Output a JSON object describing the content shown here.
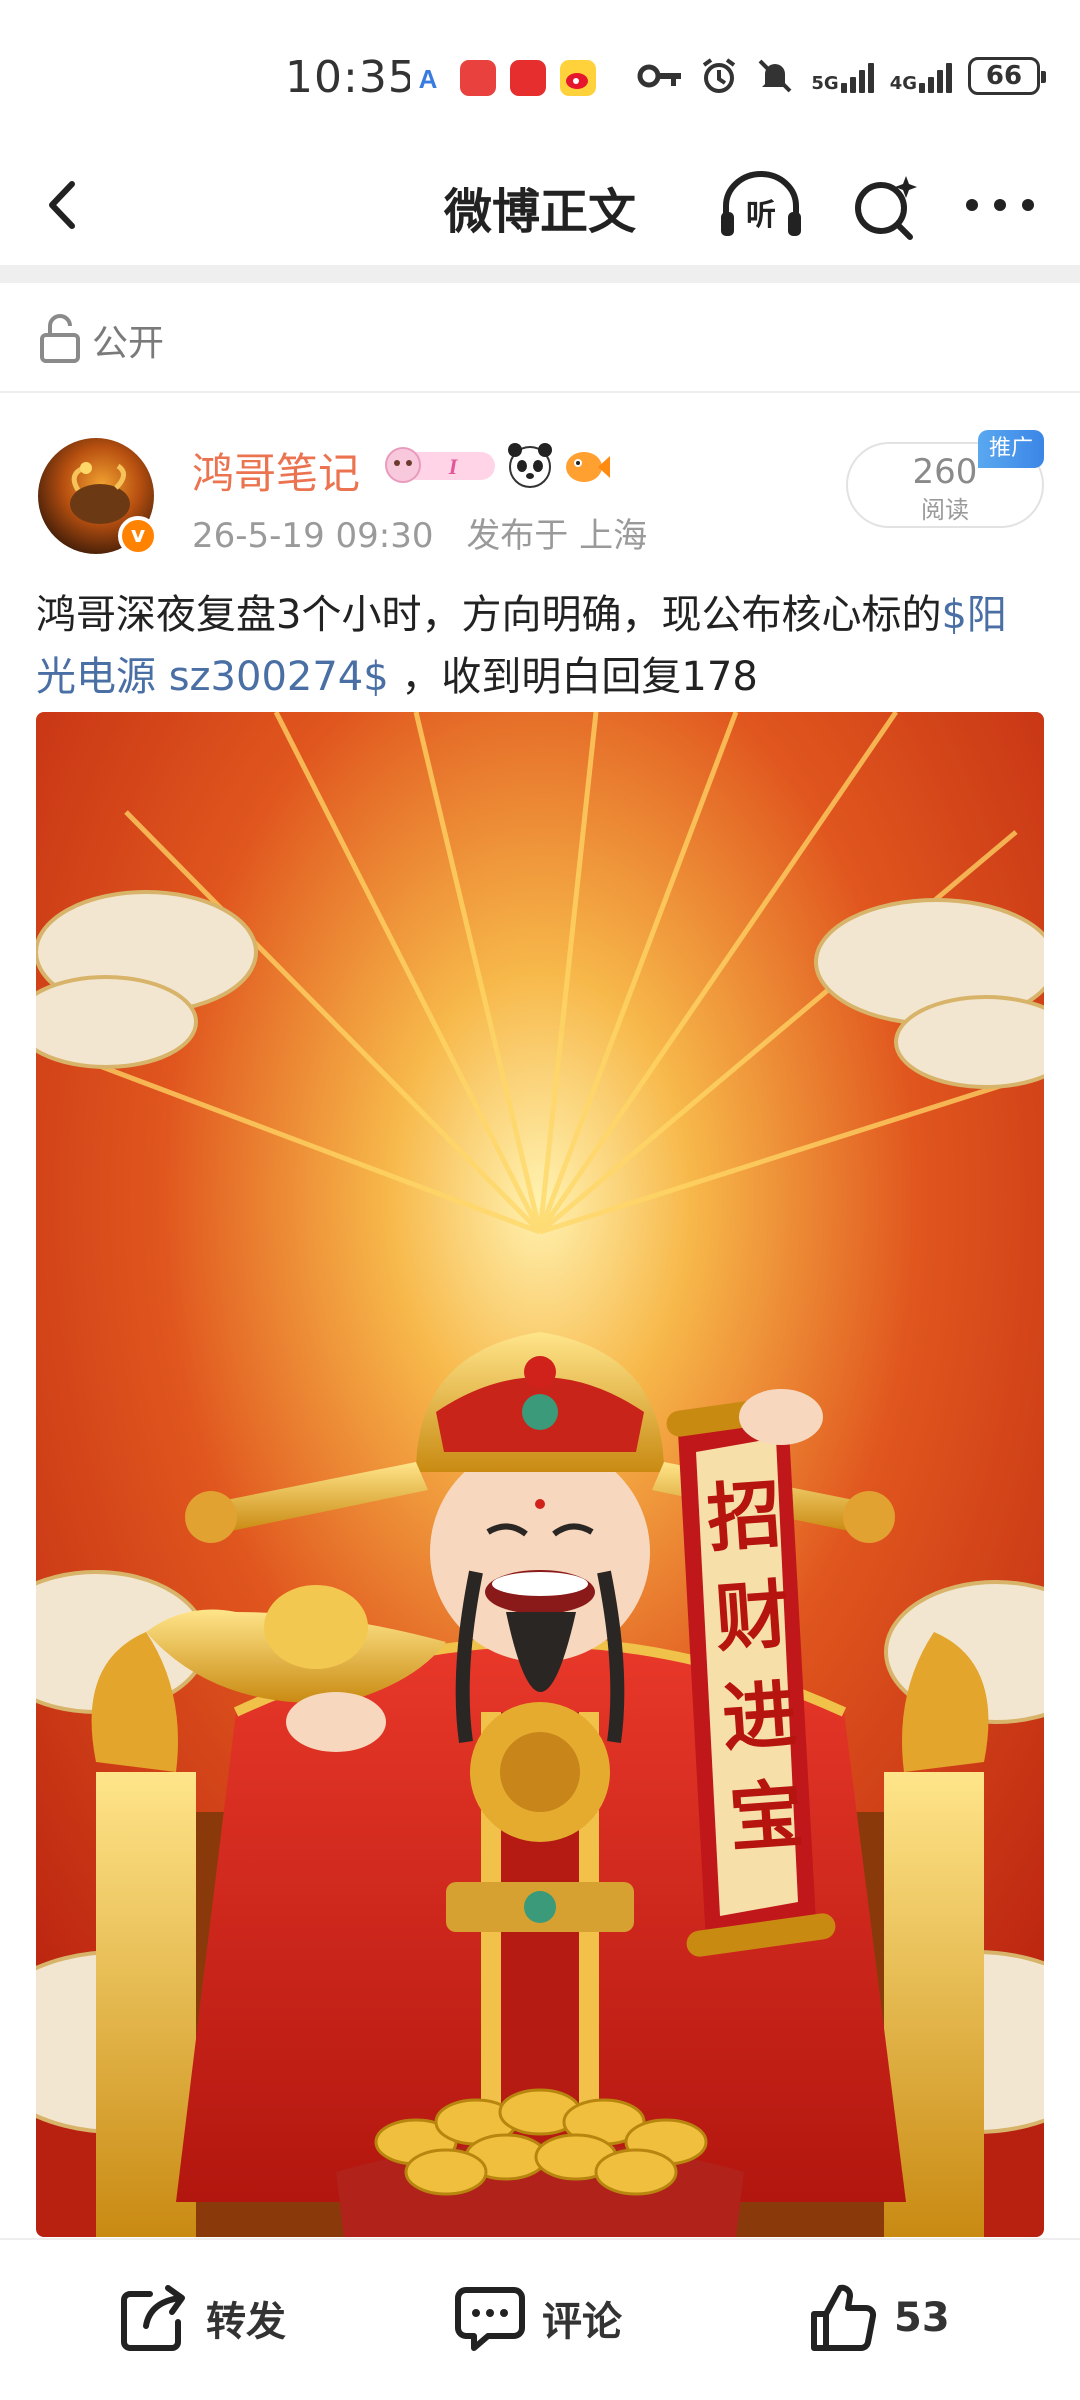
{
  "status_bar": {
    "time": "10:35",
    "network_1": "5G",
    "network_2": "4G",
    "battery": "66",
    "icons": [
      "key-icon",
      "alarm-icon",
      "mute-icon"
    ],
    "app_icons": [
      "a-app-icon",
      "huawei-store-icon",
      "red-app-icon",
      "weibo-app-icon"
    ]
  },
  "navbar": {
    "title": "微博正文",
    "listen_label": "听"
  },
  "privacy": {
    "label": "公开"
  },
  "post": {
    "author": "鸿哥笔记",
    "timestamp": "26-5-19 09:30",
    "location": "发布于 上海",
    "read_count": "260",
    "read_label": "阅读",
    "promo_tag": "推广",
    "verified_icon": "v",
    "badge_letter": "I",
    "text_part1": "鸿哥深夜复盘3个小时，方向明确，现公布核心标的",
    "topic": "$阳光电源 sz300274$",
    "text_part2": " ，收到明白回复178",
    "image_scroll_text": [
      "招",
      "财",
      "进",
      "宝"
    ]
  },
  "bottom_bar": {
    "repost_label": "转发",
    "comment_label": "评论",
    "like_count": "53"
  },
  "colors": {
    "username": "#eb7350",
    "topic_link": "#4a6fa5",
    "promo": "#3b86e6",
    "verify": "#ff8200"
  }
}
